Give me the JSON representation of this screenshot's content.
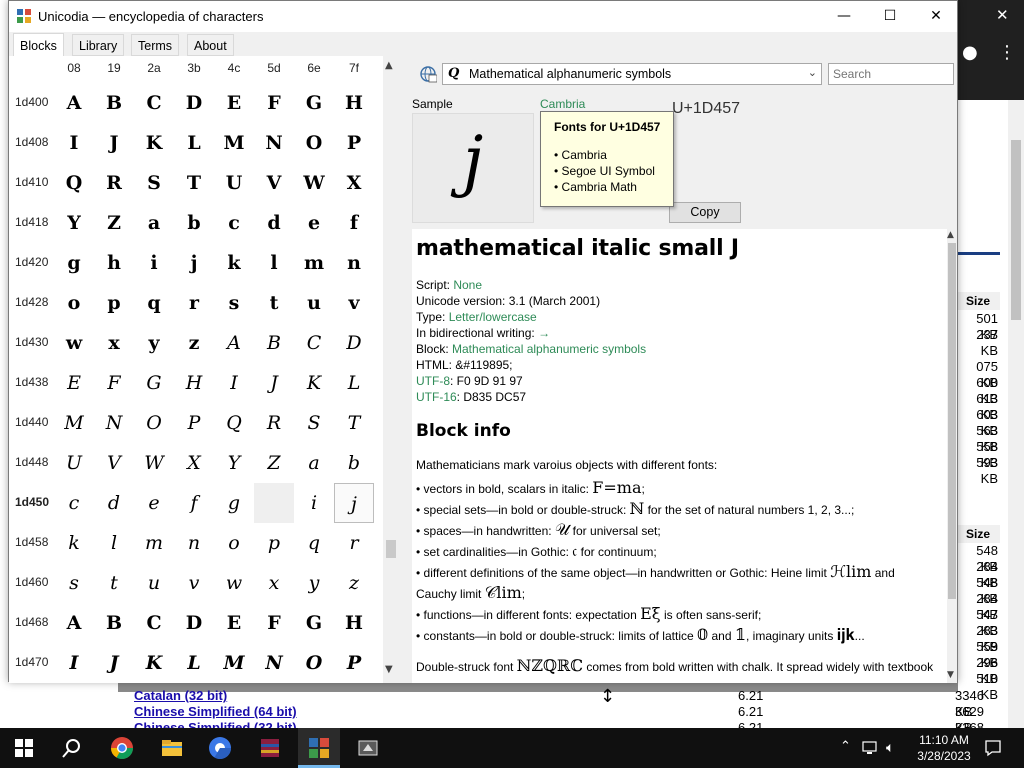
{
  "window": {
    "title": "Unicodia — encyclopedia of characters",
    "minimize": "—",
    "maximize": "☐",
    "close": "✕"
  },
  "tabs": [
    "Blocks",
    "Library",
    "Terms",
    "About"
  ],
  "grid": {
    "columns": [
      "08",
      "19",
      "2a",
      "3b",
      "4c",
      "5d",
      "6e",
      "7f"
    ],
    "rows": [
      {
        "label": "1d400",
        "style": "bold",
        "chars": [
          "A",
          "B",
          "C",
          "D",
          "E",
          "F",
          "G",
          "H"
        ]
      },
      {
        "label": "1d408",
        "style": "bold",
        "chars": [
          "I",
          "J",
          "K",
          "L",
          "M",
          "N",
          "O",
          "P"
        ]
      },
      {
        "label": "1d410",
        "style": "bold",
        "chars": [
          "Q",
          "R",
          "S",
          "T",
          "U",
          "V",
          "W",
          "X"
        ]
      },
      {
        "label": "1d418",
        "style": "bold",
        "chars": [
          "Y",
          "Z",
          "a",
          "b",
          "c",
          "d",
          "e",
          "f"
        ]
      },
      {
        "label": "1d420",
        "style": "bold",
        "chars": [
          "g",
          "h",
          "i",
          "j",
          "k",
          "l",
          "m",
          "n"
        ]
      },
      {
        "label": "1d428",
        "style": "bold",
        "chars": [
          "o",
          "p",
          "q",
          "r",
          "s",
          "t",
          "u",
          "v"
        ]
      },
      {
        "label": "1d430",
        "style": "mixed",
        "chars": [
          "w",
          "x",
          "y",
          "z",
          "A",
          "B",
          "C",
          "D"
        ]
      },
      {
        "label": "1d438",
        "style": "ital",
        "chars": [
          "E",
          "F",
          "G",
          "H",
          "I",
          "J",
          "K",
          "L"
        ]
      },
      {
        "label": "1d440",
        "style": "ital",
        "chars": [
          "M",
          "N",
          "O",
          "P",
          "Q",
          "R",
          "S",
          "T"
        ]
      },
      {
        "label": "1d448",
        "style": "ital",
        "chars": [
          "U",
          "V",
          "W",
          "X",
          "Y",
          "Z",
          "a",
          "b"
        ]
      },
      {
        "label": "1d450",
        "style": "ital",
        "current": true,
        "chars": [
          "c",
          "d",
          "e",
          "f",
          "g",
          "",
          "i",
          "j"
        ]
      },
      {
        "label": "1d458",
        "style": "ital",
        "chars": [
          "k",
          "l",
          "m",
          "n",
          "o",
          "p",
          "q",
          "r"
        ]
      },
      {
        "label": "1d460",
        "style": "ital",
        "chars": [
          "s",
          "t",
          "u",
          "v",
          "w",
          "x",
          "y",
          "z"
        ]
      },
      {
        "label": "1d468",
        "style": "bold",
        "chars": [
          "A",
          "B",
          "C",
          "D",
          "E",
          "F",
          "G",
          "H"
        ]
      },
      {
        "label": "1d470",
        "style": "bolditalic",
        "chars": [
          "I",
          "J",
          "K",
          "L",
          "M",
          "N",
          "O",
          "P"
        ]
      }
    ]
  },
  "toolbar": {
    "block_select": "Mathematical alphanumeric symbols",
    "search_placeholder": "Search"
  },
  "sample": {
    "label": "Sample",
    "glyph": "j",
    "font_link": "Cambria",
    "codepoint": "U+1D457",
    "copy_label": "Copy"
  },
  "tooltip": {
    "title": "Fonts for U+1D457",
    "fonts": [
      "• Cambria",
      "• Segoe UI Symbol",
      "• Cambria Math"
    ]
  },
  "info": {
    "name": "mathematical italic small J",
    "script_label": "Script: ",
    "script_value": "None",
    "version": "Unicode version: 3.1 (March 2001)",
    "type_label": "Type: ",
    "type_value": "Letter/lowercase",
    "bidi_label": "In bidirectional writing: ",
    "bidi_value": "→",
    "block_label": "Block: ",
    "block_value": "Mathematical alphanumeric symbols",
    "html": "HTML: &#119895;",
    "utf8_label": "UTF-8",
    "utf8_value": ": F0 9D 91 97",
    "utf16_label": "UTF-16",
    "utf16_value": ": D835 DC57",
    "block_info_heading": "Block info",
    "intro": "Mathematicians mark varoius objects with different fonts:",
    "bullets": [
      {
        "text": "• vectors in bold, scalars in italic: ",
        "sym": "F=ma",
        "after": ";"
      },
      {
        "text": "• special sets—in bold or double-struck: ",
        "sym": "ℕ",
        "after": " for the set of natural numbers 1, 2, 3...;"
      },
      {
        "text": "• spaces—in handwritten: ",
        "sym": "𝒰",
        "after": " for universal set;"
      },
      {
        "text": "• set cardinalities—in Gothic: ",
        "sym": "𝔠",
        "after": " for continuum;"
      },
      {
        "text": "• different definitions of the same object—in handwritten or Gothic: Heine limit ",
        "sym": "ℋlim",
        "after": " and"
      },
      {
        "text": "Cauchy limit ",
        "sym": "𝒞lim",
        "after": ";"
      },
      {
        "text": "• functions—in different fonts: expectation ",
        "sym": "Eξ",
        "after": " is often sans-serif;"
      },
      {
        "text": "• constants—in bold or double-struck: limits of lattice ",
        "sym": "𝟘",
        "after": " and ",
        "sym2": "𝟙",
        "after2": ", imaginary units ",
        "sym3": "𝐢𝐣𝐤",
        "after3": "..."
      }
    ],
    "double_struck_pre": "Double-struck font ",
    "double_struck_sym": "ℕℤℚℝℂ",
    "double_struck_post": " comes from bold written with chalk. It spread widely with textbook"
  },
  "background": {
    "size_header_1": "Size",
    "sizes_1": [
      "501 KB",
      "237 KB",
      "",
      "075 KB",
      "600 KB",
      "613 KB",
      "603 KB",
      "563 KB",
      "558 KB",
      "593 KB"
    ],
    "size_header_2": "Size",
    "sizes_2": [
      "548 KB",
      "284 KB",
      "548 KB",
      "284 KB",
      "547 KB",
      "283 KB",
      "559 KB",
      "296 KB",
      "510 KB"
    ],
    "rows": [
      {
        "name": "Catalan (32 bit)",
        "v1": "6.21",
        "v2": "3346 KB"
      },
      {
        "name": "Chinese Simplified (64 bit)",
        "v1": "6.21",
        "v2": "3629 KB"
      },
      {
        "name": "Chinese Simplified (32 bit)",
        "v1": "6.21",
        "v2": "3368 KB"
      }
    ]
  },
  "taskbar": {
    "time": "11:10 AM",
    "date": "3/28/2023"
  }
}
